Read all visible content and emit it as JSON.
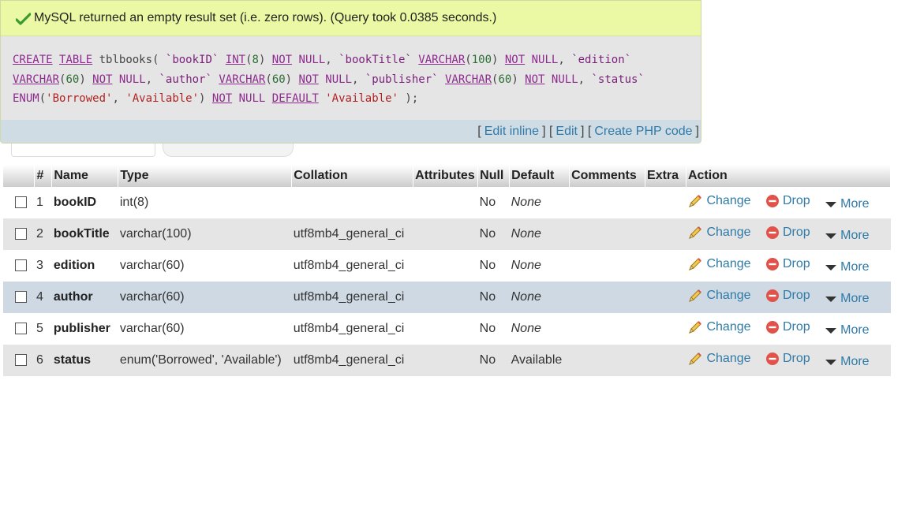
{
  "message": {
    "text": "MySQL returned an empty result set (i.e. zero rows). (Query took 0.0385 seconds.)"
  },
  "links": {
    "edit_inline": "Edit inline",
    "edit": "Edit",
    "create_php": "Create PHP code"
  },
  "table": {
    "headers": {
      "num": "#",
      "name": "Name",
      "type": "Type",
      "collation": "Collation",
      "attributes": "Attributes",
      "null": "Null",
      "default": "Default",
      "comments": "Comments",
      "extra": "Extra",
      "action": "Action"
    },
    "actions": {
      "change": "Change",
      "drop": "Drop",
      "more": "More"
    },
    "rows": [
      {
        "num": "1",
        "name": "bookID",
        "type": "int(8)",
        "collation": "",
        "null": "No",
        "default": "None"
      },
      {
        "num": "2",
        "name": "bookTitle",
        "type": "varchar(100)",
        "collation": "utf8mb4_general_ci",
        "null": "No",
        "default": "None"
      },
      {
        "num": "3",
        "name": "edition",
        "type": "varchar(60)",
        "collation": "utf8mb4_general_ci",
        "null": "No",
        "default": "None"
      },
      {
        "num": "4",
        "name": "author",
        "type": "varchar(60)",
        "collation": "utf8mb4_general_ci",
        "null": "No",
        "default": "None"
      },
      {
        "num": "5",
        "name": "publisher",
        "type": "varchar(60)",
        "collation": "utf8mb4_general_ci",
        "null": "No",
        "default": "None"
      },
      {
        "num": "6",
        "name": "status",
        "type": "enum('Borrowed', 'Available')",
        "collation": "utf8mb4_general_ci",
        "null": "No",
        "default": "Available"
      }
    ]
  },
  "colors": {
    "success_bg": "#ebf8a4",
    "link": "#2e7aa8",
    "highlight_row": "#ced9e4",
    "drop_icon": "#e0524a"
  }
}
